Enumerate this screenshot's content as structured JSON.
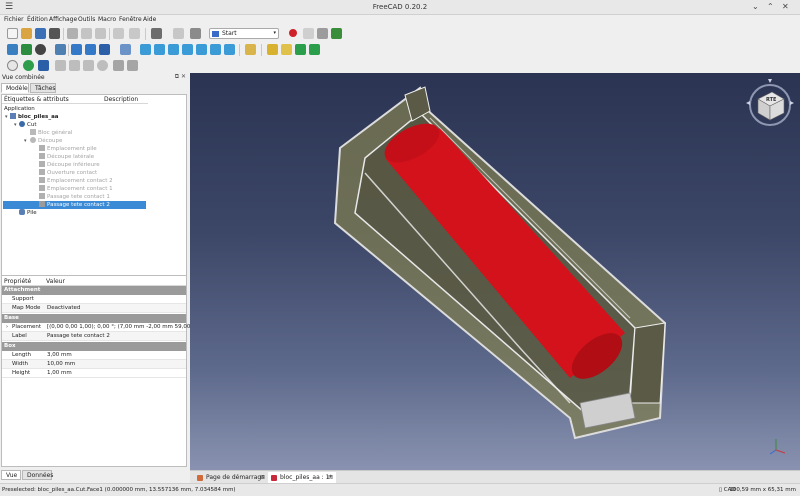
{
  "window": {
    "title": "FreeCAD 0.20.2",
    "menu_icon": "hamburger-icon",
    "controls": [
      "chevron-down-icon",
      "chevron-up-icon",
      "close-icon"
    ]
  },
  "menu": [
    "Fichier",
    "Édition",
    "Affichage",
    "Outils",
    "Macro",
    "Fenêtre",
    "Aide"
  ],
  "workbench": {
    "selected": "Start",
    "icon": "start-workbench-icon"
  },
  "combo_view": {
    "title": "Vue combinée",
    "tabs": [
      "Modèle",
      "Tâches"
    ],
    "tree_header": {
      "col1": "Étiquettes & attributs",
      "col2": "Description"
    },
    "tree_root": "Application",
    "tree": [
      {
        "label": "bloc_piles_aa",
        "bold": true,
        "level": 0,
        "icon": "document-icon",
        "expanded": true
      },
      {
        "label": "Cut",
        "level": 1,
        "icon": "cut-icon",
        "expanded": true
      },
      {
        "label": "Bloc général",
        "level": 2,
        "icon": "solid-icon",
        "grey": true
      },
      {
        "label": "Découpe",
        "level": 2,
        "icon": "cut-icon",
        "grey": true,
        "expanded": true
      },
      {
        "label": "Emplacement pile",
        "level": 3,
        "icon": "solid-icon",
        "grey": true
      },
      {
        "label": "Découpe latérale",
        "level": 3,
        "icon": "solid-icon",
        "grey": true
      },
      {
        "label": "Découpe inférieure",
        "level": 3,
        "icon": "solid-icon",
        "grey": true
      },
      {
        "label": "Ouverture contact",
        "level": 3,
        "icon": "solid-icon",
        "grey": true
      },
      {
        "label": "Emplacement contact 2",
        "level": 3,
        "icon": "solid-icon",
        "grey": true
      },
      {
        "label": "Emplacement contact 1",
        "level": 3,
        "icon": "solid-icon",
        "grey": true
      },
      {
        "label": "Passage tete contact 1",
        "level": 3,
        "icon": "solid-icon",
        "grey": true
      },
      {
        "label": "Passage tete contact 2",
        "level": 3,
        "icon": "solid-icon",
        "selected": true
      },
      {
        "label": "Pile",
        "level": 1,
        "icon": "cylinder-icon"
      }
    ],
    "props_header": {
      "col1": "Propriété",
      "col2": "Valeur"
    },
    "properties": [
      {
        "group": "Attachment"
      },
      {
        "name": "Support",
        "value": ""
      },
      {
        "name": "Map Mode",
        "value": "Deactivated"
      },
      {
        "group": "Base"
      },
      {
        "name": "Placement",
        "value": "[(0,00 0,00 1,00); 0,00 °; (7,00 mm  -2,00 mm  59,00 mm)]",
        "expandable": true
      },
      {
        "name": "Label",
        "value": "Passage tete contact 2"
      },
      {
        "group": "Box"
      },
      {
        "name": "Length",
        "value": "3,00 mm"
      },
      {
        "name": "Width",
        "value": "10,00 mm"
      },
      {
        "name": "Height",
        "value": "1,00 mm"
      }
    ],
    "bottom_tabs": [
      "Vue",
      "Données"
    ]
  },
  "viewcube": {
    "face_label": "RTE"
  },
  "doc_tabs": [
    {
      "label": "Page de démarrage",
      "close": "⊠",
      "active": false
    },
    {
      "label": "bloc_piles_aa : 1*",
      "close": "⊠",
      "active": true
    }
  ],
  "status": {
    "message": "Preselected: bloc_piles_aa.Cut.Face1 (0.000000 mm, 13.557136 mm, 7.034584 mm)",
    "nav_style": "CAD",
    "dimensions": "100,59 mm x 65,31 mm"
  },
  "colors": {
    "selection": "#3a8ad6",
    "cylinder": "#d4121b",
    "body": "#8d8b5b",
    "group_row": "#9a9a9a"
  }
}
